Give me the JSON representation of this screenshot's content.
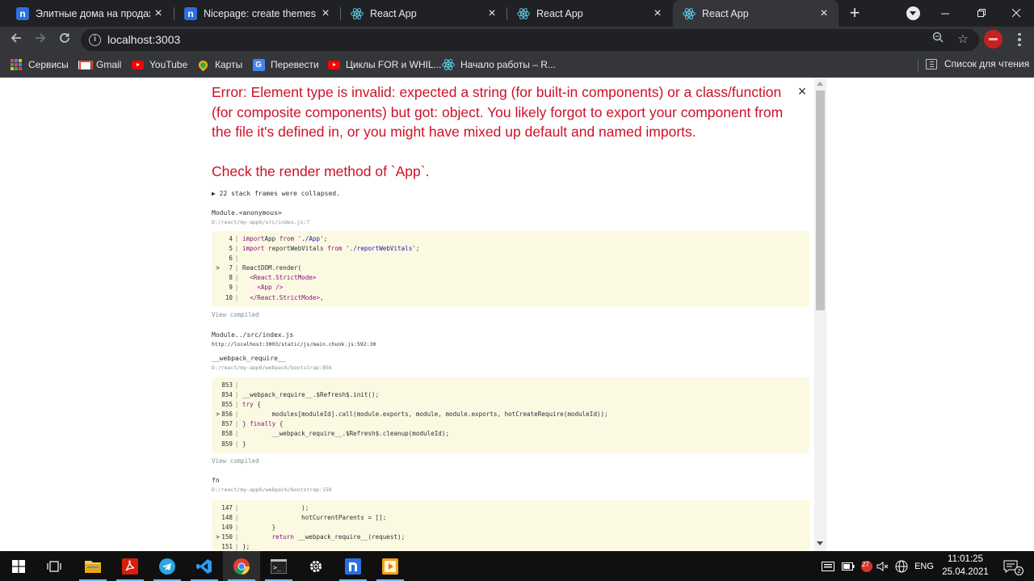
{
  "browser": {
    "tabs": [
      {
        "title": "Элитные дома на продажу l",
        "favicon": "nicepage-icon"
      },
      {
        "title": "Nicepage: create themes and",
        "favicon": "nicepage-icon"
      },
      {
        "title": "React App",
        "favicon": "react-icon"
      },
      {
        "title": "React App",
        "favicon": "react-icon"
      },
      {
        "title": "React App",
        "favicon": "react-icon"
      }
    ],
    "active_tab_index": 4,
    "new_tab_label": "+",
    "url": "localhost:3003",
    "bookmarks": [
      {
        "label": "Сервисы",
        "icon": "apps-grid-icon"
      },
      {
        "label": "Gmail",
        "icon": "gmail-icon"
      },
      {
        "label": "YouTube",
        "icon": "youtube-icon"
      },
      {
        "label": "Карты",
        "icon": "maps-icon"
      },
      {
        "label": "Перевести",
        "icon": "google-translate-icon"
      },
      {
        "label": "Циклы FOR и WHIL...",
        "icon": "youtube-icon"
      },
      {
        "label": "Начало работы – R...",
        "icon": "react-icon"
      }
    ],
    "reading_list_label": "Список для чтения"
  },
  "error_overlay": {
    "title": "Error: Element type is invalid: expected a string (for built-in components) or a class/function (for composite components) but got: object. You likely forgot to export your component from the file it's defined in, or you might have mixed up default and named imports.",
    "check": "Check the render method of `App`.",
    "close_label": "×",
    "collapsed_text": "▶ 22 stack frames were collapsed.",
    "view_compiled_label": "View compiled",
    "frames": [
      {
        "fn": "Module.<anonymous>",
        "file": "D:/react/my-app6/src/index.js:7",
        "code": [
          {
            "marker": "",
            "ln": "4",
            "parts": [
              [
                "kw",
                "import"
              ],
              [
                "",
                "App "
              ],
              [
                "kw",
                "from"
              ],
              [
                "",
                " "
              ],
              [
                "str",
                "'./App'"
              ],
              [
                "",
                ";"
              ]
            ]
          },
          {
            "marker": "",
            "ln": "5",
            "parts": [
              [
                "kw",
                "import"
              ],
              [
                "",
                " reportWebVitals "
              ],
              [
                "kw",
                "from"
              ],
              [
                "",
                " "
              ],
              [
                "str",
                "'./reportWebVitals'"
              ],
              [
                "",
                ";"
              ]
            ]
          },
          {
            "marker": "",
            "ln": "6",
            "parts": []
          },
          {
            "marker": ">",
            "ln": "7",
            "parts": [
              [
                "",
                "ReactDOM.render("
              ]
            ]
          },
          {
            "marker": "",
            "ln": "8",
            "parts": [
              [
                "",
                "  "
              ],
              [
                "tag",
                "<React.StrictMode>"
              ]
            ]
          },
          {
            "marker": "",
            "ln": "9",
            "parts": [
              [
                "",
                "    "
              ],
              [
                "tag",
                "<App />"
              ]
            ]
          },
          {
            "marker": "",
            "ln": "10",
            "parts": [
              [
                "",
                "  "
              ],
              [
                "tag",
                "</React.StrictMode>"
              ],
              [
                "",
                ","
              ]
            ]
          }
        ]
      },
      {
        "fn": "Module../src/index.js",
        "file": "http://localhost:3003/static/js/main.chunk.js:592:30",
        "code": []
      },
      {
        "fn": "__webpack_require__",
        "file": "D:/react/my-app6/webpack/bootstrap:856",
        "code": [
          {
            "marker": "",
            "ln": "853",
            "parts": []
          },
          {
            "marker": "",
            "ln": "854",
            "parts": [
              [
                "",
                "__webpack_require__.$Refresh$.init();"
              ]
            ]
          },
          {
            "marker": "",
            "ln": "855",
            "parts": [
              [
                "kw",
                "try"
              ],
              [
                "",
                " {"
              ]
            ]
          },
          {
            "marker": ">",
            "ln": "856",
            "parts": [
              [
                "",
                "        modules[moduleId].call(module.exports, module, module.exports, hotCreateRequire(moduleId));"
              ]
            ]
          },
          {
            "marker": "",
            "ln": "857",
            "parts": [
              [
                "",
                "} "
              ],
              [
                "kw",
                "finally"
              ],
              [
                "",
                " {"
              ]
            ]
          },
          {
            "marker": "",
            "ln": "858",
            "parts": [
              [
                "",
                "        __webpack_require__.$Refresh$.cleanup(moduleId);"
              ]
            ]
          },
          {
            "marker": "",
            "ln": "859",
            "parts": [
              [
                "",
                "}"
              ]
            ]
          }
        ]
      },
      {
        "fn": "fn",
        "file": "D:/react/my-app6/webpack/bootstrap:150",
        "code": [
          {
            "marker": "",
            "ln": "147",
            "parts": [
              [
                "",
                "                );"
              ]
            ]
          },
          {
            "marker": "",
            "ln": "148",
            "parts": [
              [
                "",
                "                hotCurrentParents = [];"
              ]
            ]
          },
          {
            "marker": "",
            "ln": "149",
            "parts": [
              [
                "",
                "        }"
              ]
            ]
          },
          {
            "marker": ">",
            "ln": "150",
            "parts": [
              [
                "",
                "        "
              ],
              [
                "kw",
                "return"
              ],
              [
                "",
                " __webpack_require__(request);"
              ]
            ]
          },
          {
            "marker": "",
            "ln": "151",
            "parts": [
              [
                "",
                "};"
              ]
            ]
          }
        ]
      }
    ]
  },
  "taskbar": {
    "apps": [
      "windows-start-icon",
      "task-view-icon",
      "file-explorer-icon",
      "acrobat-icon",
      "telegram-icon",
      "vscode-icon",
      "chrome-icon",
      "terminal-icon",
      "settings-icon",
      "nicepage-icon",
      "media-player-icon"
    ],
    "notification_badge": "27",
    "language": "ENG",
    "time": "11:01:25",
    "date": "25.04.2021",
    "notification_count": "2"
  },
  "colors": {
    "error_red": "#ce1126",
    "code_bg": "#fcf9e3",
    "chrome_dark": "#202124",
    "chrome_toolbar": "#35363a",
    "taskbar": "#101010"
  }
}
